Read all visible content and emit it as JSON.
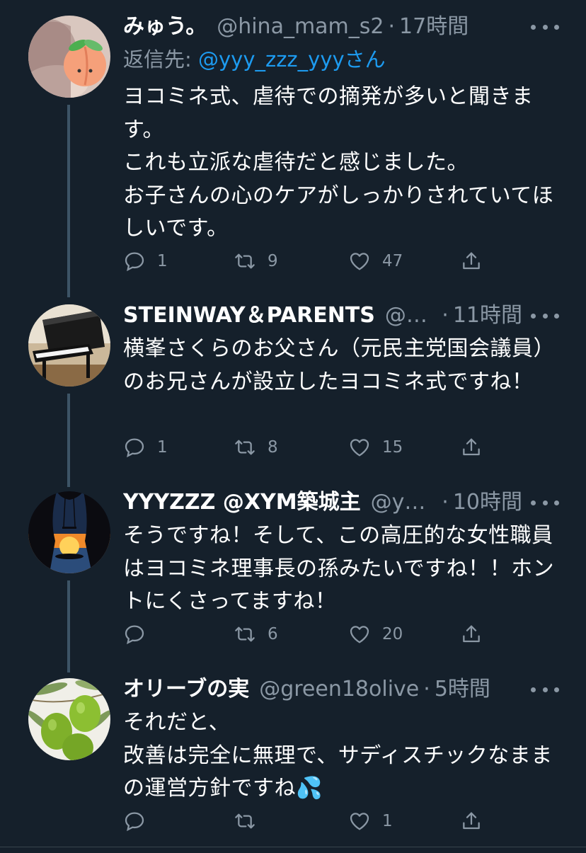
{
  "tweets": [
    {
      "name": "みゅう。",
      "handle": "@hina_mam_s2",
      "dot": "·",
      "time": "17時間",
      "reply_prefix": "返信先: ",
      "reply_mention": "@yyy_zzz_yyyさん",
      "body": "ヨコミネ式、虐待での摘発が多いと聞きます。\nこれも立派な虐待だと感じました。\nお子さんの心のケアがしっかりされていてほしいです。",
      "replies": "1",
      "retweets": "9",
      "likes": "47",
      "avatar_icon": "peach-icon"
    },
    {
      "name": "STEINWAY＆PARENTS",
      "handle": "@st…",
      "dot": "·",
      "time": "11時間",
      "body": "横峯さくらのお父さん（元民主党国会議員）のお兄さんが設立したヨコミネ式ですね！",
      "replies": "1",
      "retweets": "8",
      "likes": "15",
      "avatar_icon": "grand-piano-icon"
    },
    {
      "name": "YYYZZZ @XYM築城主",
      "handle": "@yy…",
      "dot": "·",
      "time": "10時間",
      "body": "そうですね！そして、この高圧的な女性職員はヨコミネ理事長の孫みたいですね！！ホントにくさってますね！",
      "replies": "",
      "retweets": "6",
      "likes": "20",
      "avatar_icon": "sunset-silhouette-icon"
    },
    {
      "name": "オリーブの実",
      "handle": "@green18olive",
      "dot": "·",
      "time": "5時間",
      "body": "それだと、\n改善は完全に無理で、サディスチックなままの運営方針ですね",
      "body_emoji": "💦",
      "replies": "",
      "retweets": "",
      "likes": "1",
      "avatar_icon": "olive-icon"
    }
  ],
  "colors": {
    "background": "#15202b",
    "text": "#ffffff",
    "secondary": "#8b98a5",
    "link": "#1d9bf0",
    "thread_line": "#3d5466"
  }
}
